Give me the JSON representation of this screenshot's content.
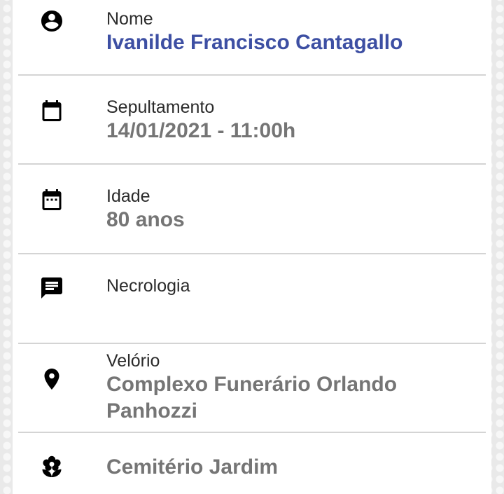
{
  "colors": {
    "accent": "#3d4fa3",
    "value_text": "#757575",
    "label_text": "#2b2b2b",
    "divider": "#d4d4d4"
  },
  "fields": {
    "nome": {
      "icon": "account-circle-icon",
      "label": "Nome",
      "value": "Ivanilde Francisco Cantagallo"
    },
    "sepultamento": {
      "icon": "calendar-icon",
      "label": "Sepultamento",
      "value": "14/01/2021 - 11:00h"
    },
    "idade": {
      "icon": "calendar-dots-icon",
      "label": "Idade",
      "value": "80 anos"
    },
    "necrologia": {
      "icon": "message-icon",
      "label": "Necrologia",
      "value": ""
    },
    "velorio": {
      "icon": "location-pin-icon",
      "label": "Velório",
      "value": "Complexo Funerário Orlando Panhozzi"
    },
    "cemiterio": {
      "icon": "flower-icon",
      "value": "Cemitério Jardim"
    }
  }
}
